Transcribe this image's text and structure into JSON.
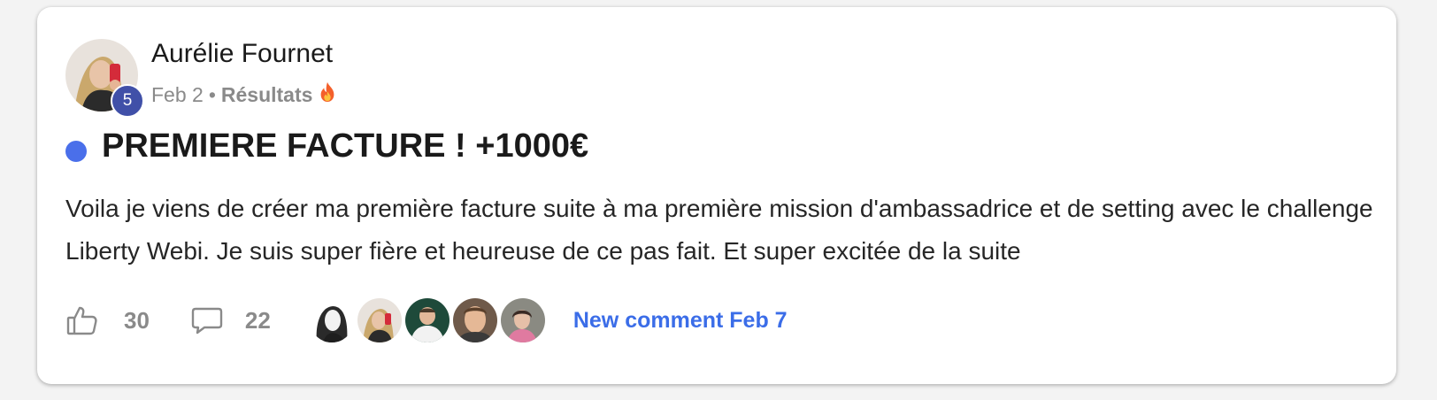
{
  "post": {
    "author": {
      "name": "Aurélie Fournet",
      "level": "5",
      "avatar_icon": "user-avatar-photo"
    },
    "date": "Feb 2",
    "separator": "•",
    "category": "Résultats",
    "category_emoji": "fire-emoji",
    "title": "PREMIERE FACTURE ! +1000€",
    "unread_indicator_color": "#4a6fea",
    "body": "Voila je viens de créer ma première facture suite à ma première mission d'ambassadrice et de setting avec le challenge Liberty Webi. Je suis super fière et heureuse de ce pas fait. Et super excitée de la suite",
    "likes": "30",
    "comments": "22",
    "commenter_avatars": [
      "commenter-avatar-1",
      "commenter-avatar-2",
      "commenter-avatar-3",
      "commenter-avatar-4",
      "commenter-avatar-5"
    ],
    "new_comment_label": "New comment Feb 7",
    "colors": {
      "accent": "#3b6de8",
      "level_badge": "#4050a8",
      "muted_text": "#8a8a8a"
    }
  }
}
